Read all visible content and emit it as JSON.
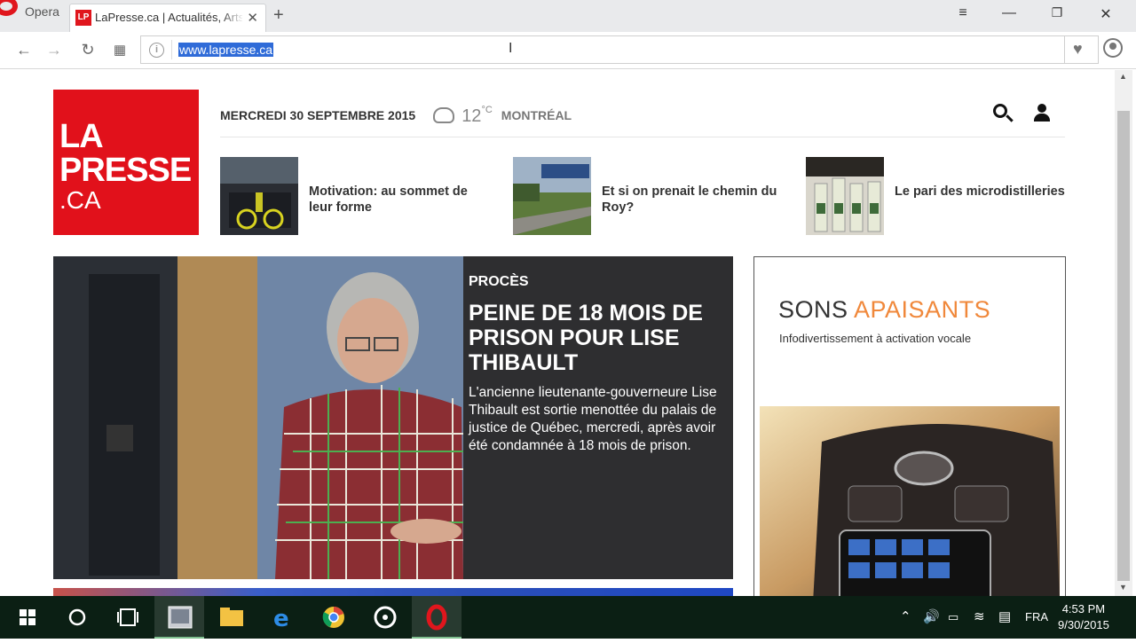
{
  "browser": {
    "menu_label": "Opera",
    "tab": {
      "favicon": "LP",
      "title": "LaPresse.ca | Actualités, Arts"
    },
    "url": "www.lapresse.ca",
    "window_controls": [
      "minimize",
      "restore",
      "close"
    ]
  },
  "site": {
    "logo": {
      "line1": "LA",
      "line2": "PRESSE",
      "line3": ".CA"
    },
    "date": "MERCREDI 30 SEPTEMBRE 2015",
    "weather": {
      "temp": "12",
      "unit": "°C",
      "city": "MONTRÉAL",
      "icon": "cloud-rain-icon"
    },
    "teasers": [
      {
        "title": "Motivation: au sommet de leur forme"
      },
      {
        "title": "Et si on prenait le chemin du Roy?"
      },
      {
        "title": "Le pari des microdistilleries"
      }
    ],
    "hero": {
      "kicker": "PROCÈS",
      "headline": "PEINE DE 18 MOIS DE PRISON POUR LISE THIBAULT",
      "summary": "L'ancienne lieutenante-gouverneure Lise Thibault est sortie menottée du palais de justice de Québec, mercredi, après avoir été condamnée à 18 mois de prison."
    },
    "ad": {
      "title_part1": "SONS ",
      "title_part2": "APAISANTS",
      "subtitle": "Infodivertissement à activation vocale",
      "accent": "#f0883b"
    },
    "brand_color": "#e1111b"
  },
  "taskbar": {
    "language": "FRA",
    "time": "4:53 PM",
    "date": "9/30/2015"
  }
}
